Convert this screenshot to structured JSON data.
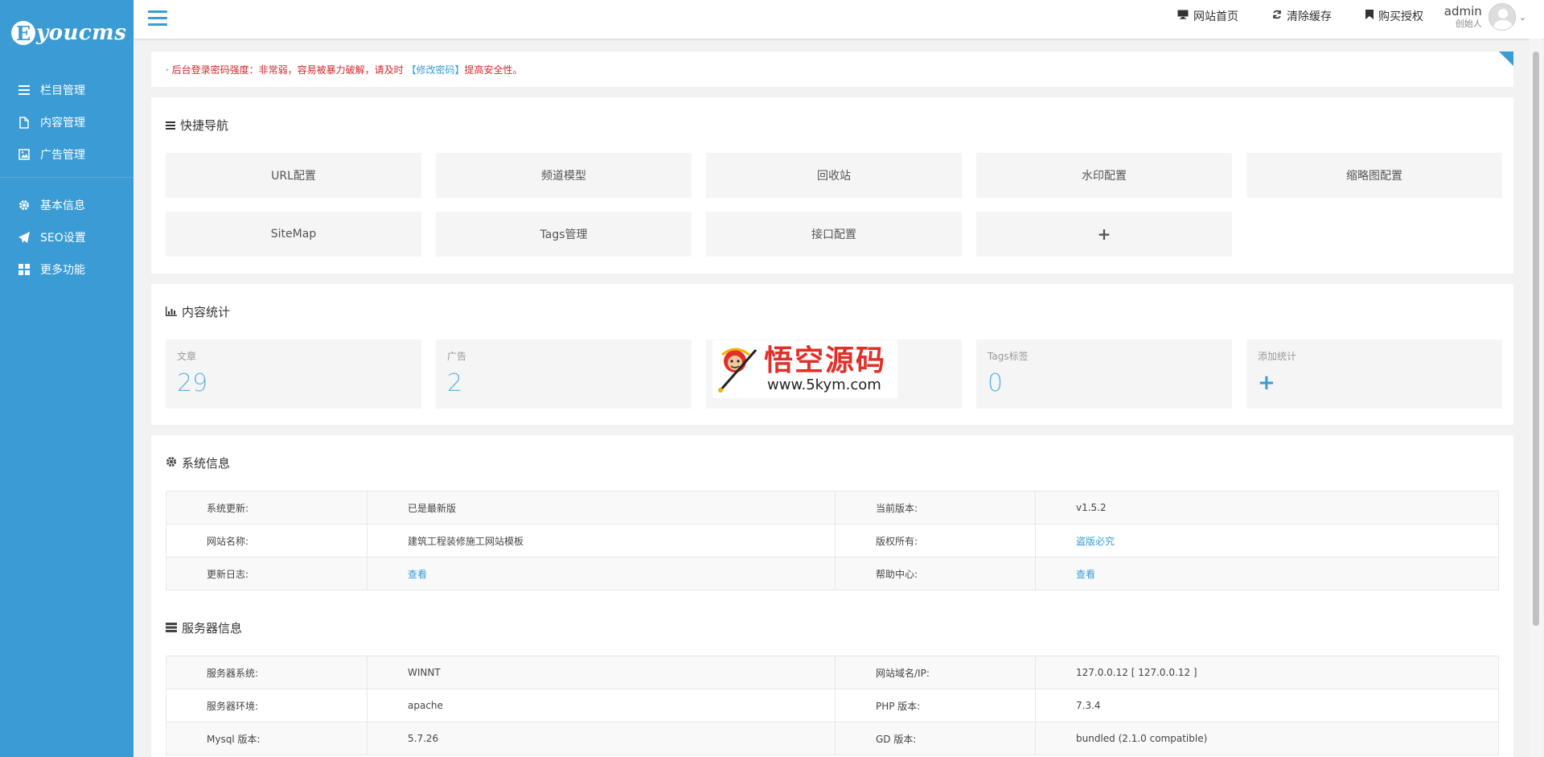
{
  "brand": {
    "mark": "E",
    "name": "youcms"
  },
  "sidebar": {
    "group1": [
      {
        "label": "栏目管理",
        "icon": "list-icon"
      },
      {
        "label": "内容管理",
        "icon": "file-icon"
      },
      {
        "label": "广告管理",
        "icon": "image-icon"
      }
    ],
    "group2": [
      {
        "label": "基本信息",
        "icon": "gear-icon"
      },
      {
        "label": "SEO设置",
        "icon": "paper-plane-icon"
      },
      {
        "label": "更多功能",
        "icon": "grid-icon"
      }
    ]
  },
  "header": {
    "links": [
      {
        "label": "网站首页",
        "icon": "monitor-icon"
      },
      {
        "label": "清除缓存",
        "icon": "refresh-icon"
      },
      {
        "label": "购买授权",
        "icon": "bookmark-icon"
      }
    ],
    "user": {
      "name": "admin",
      "role": "创始人"
    }
  },
  "alert": {
    "prefix": "· 后台登录密码强度：非常弱，容易被暴力破解，请及时 ",
    "link": "【修改密码】",
    "suffix": "提高安全性。"
  },
  "quick_nav": {
    "title": "快捷导航",
    "items": [
      "URL配置",
      "频道模型",
      "回收站",
      "水印配置",
      "缩略图配置",
      "SiteMap",
      "Tags管理",
      "接口配置",
      "+"
    ]
  },
  "stats": {
    "title": "内容统计",
    "items": [
      {
        "label": "文章",
        "value": "29"
      },
      {
        "label": "广告",
        "value": "2"
      },
      {
        "label": "",
        "value": ""
      },
      {
        "label": "Tags标签",
        "value": "0"
      },
      {
        "label": "添加统计",
        "value": "+"
      }
    ],
    "watermark": {
      "title": "悟空源码",
      "url": "www.5kym.com"
    }
  },
  "system_info": {
    "title": "系统信息",
    "rows": [
      {
        "k1": "系统更新:",
        "v1": "已是最新版",
        "k2": "当前版本:",
        "v2": "v1.5.2",
        "v1_link": false,
        "v2_link": false
      },
      {
        "k1": "网站名称:",
        "v1": "建筑工程装修施工网站模板",
        "k2": "版权所有:",
        "v2": "盗版必究",
        "v1_link": false,
        "v2_link": true
      },
      {
        "k1": "更新日志:",
        "v1": "查看",
        "k2": "帮助中心:",
        "v2": "查看",
        "v1_link": true,
        "v2_link": true
      }
    ]
  },
  "server_info": {
    "title": "服务器信息",
    "rows": [
      {
        "k1": "服务器系统:",
        "v1": "WINNT",
        "k2": "网站域名/IP:",
        "v2": "127.0.0.12 [ 127.0.0.12 ]"
      },
      {
        "k1": "服务器环境:",
        "v1": "apache",
        "k2": "PHP 版本:",
        "v2": "7.3.4"
      },
      {
        "k1": "Mysql 版本:",
        "v1": "5.7.26",
        "k2": "GD 版本:",
        "v2": "bundled (2.1.0 compatible)"
      }
    ]
  },
  "colors": {
    "accent": "#3a9bd5",
    "alert": "#d0282a",
    "stat_value": "#65b4e3"
  }
}
